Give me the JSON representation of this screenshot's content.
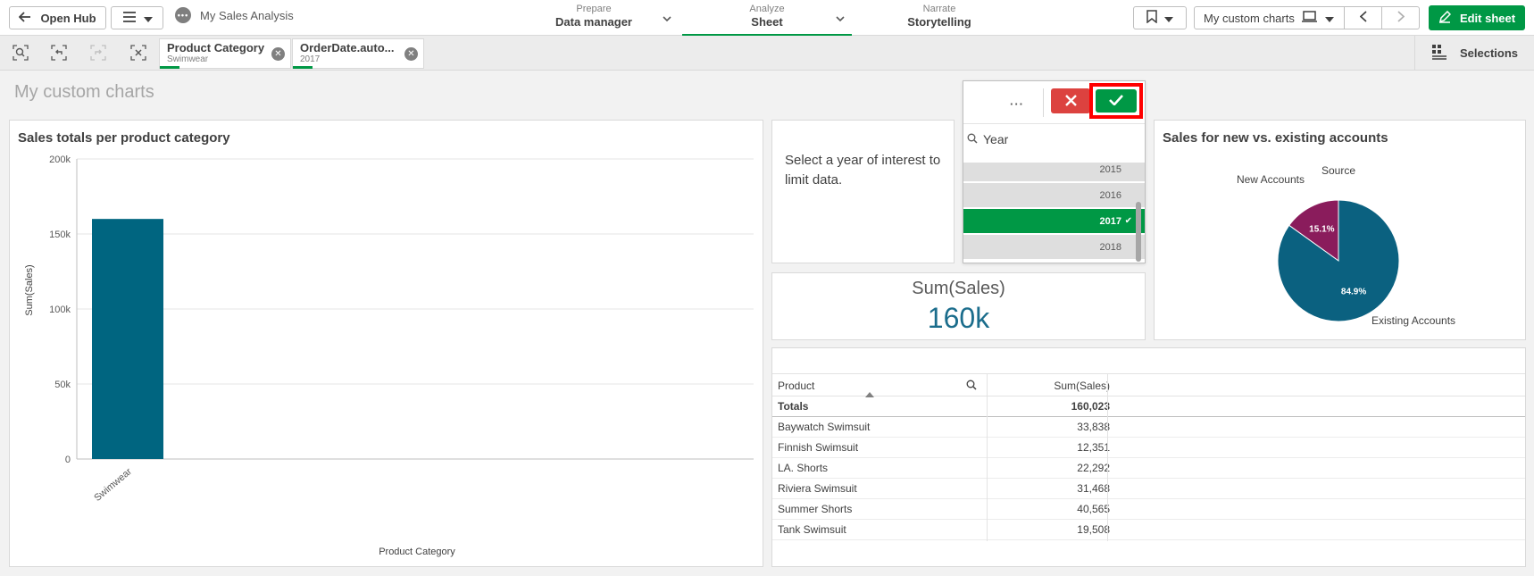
{
  "topbar": {
    "open_hub_label": "Open Hub",
    "app_name": "My Sales Analysis",
    "nav": [
      {
        "small": "Prepare",
        "big": "Data manager"
      },
      {
        "small": "Analyze",
        "big": "Sheet"
      },
      {
        "small": "Narrate",
        "big": "Storytelling"
      }
    ],
    "sheet_select_label": "My custom charts",
    "edit_sheet_label": "Edit sheet"
  },
  "selections_bar": {
    "chips": [
      {
        "field": "Product Category",
        "value": "Swimwear"
      },
      {
        "field": "OrderDate.auto...",
        "value": "2017"
      }
    ],
    "selections_label": "Selections"
  },
  "sheet_title": "My custom charts",
  "bar_chart": {
    "title": "Sales totals per product category"
  },
  "text_object": {
    "text": "Select a year of interest to limit data."
  },
  "filter_pane": {
    "field": "Year",
    "more_label": "···",
    "items": [
      {
        "label": "2015",
        "selected": false
      },
      {
        "label": "2016",
        "selected": false
      },
      {
        "label": "2017",
        "selected": true
      },
      {
        "label": "2018",
        "selected": false
      }
    ]
  },
  "kpi": {
    "label": "Sum(Sales)",
    "value": "160k"
  },
  "pie_chart": {
    "title": "Sales for new vs. existing accounts"
  },
  "table": {
    "headers": {
      "product": "Product",
      "sum": "Sum(Sales)"
    },
    "totals_label": "Totals",
    "totals_value": "160,023",
    "rows": [
      {
        "product": "Baywatch Swimsuit",
        "sum": "33,838"
      },
      {
        "product": "Finnish Swimsuit",
        "sum": "12,351"
      },
      {
        "product": "LA. Shorts",
        "sum": "22,292"
      },
      {
        "product": "Riviera Swimsuit",
        "sum": "31,468"
      },
      {
        "product": "Summer Shorts",
        "sum": "40,565"
      },
      {
        "product": "Tank Swimsuit",
        "sum": "19,508"
      }
    ]
  },
  "colors": {
    "accent_green": "#009845",
    "bar_color": "#006580",
    "new_accounts": "#8a1c5c",
    "existing_accounts": "#0b6180",
    "cancel_red": "#dc423f",
    "kpi_value": "#1b6d8c"
  },
  "chart_data": [
    {
      "type": "bar",
      "title": "Sales totals per product category",
      "xlabel": "Product Category",
      "ylabel": "Sum(Sales)",
      "categories": [
        "Swimwear"
      ],
      "values": [
        160023
      ],
      "ylim": [
        0,
        200000
      ],
      "yticks": [
        0,
        50000,
        100000,
        150000,
        200000
      ],
      "ytick_labels": [
        "0",
        "50k",
        "100k",
        "150k",
        "200k"
      ],
      "grid": true
    },
    {
      "type": "pie",
      "title": "Sales for new vs. existing accounts",
      "legend_title": "Source",
      "slices": [
        {
          "label": "New Accounts",
          "value": 15.1,
          "display": "15.1%"
        },
        {
          "label": "Existing Accounts",
          "value": 84.9,
          "display": "84.9%"
        }
      ]
    }
  ]
}
